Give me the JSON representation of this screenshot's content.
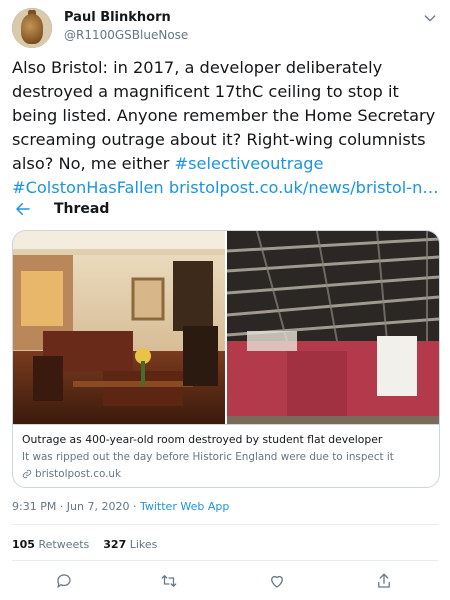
{
  "author": {
    "name": "Paul Blinkhorn",
    "handle": "@R1100GSBlueNose"
  },
  "tweet": {
    "text_plain": "Also Bristol: in 2017, a developer deliberately destroyed a magnificent 17thC ceiling to stop it being listed. Anyone remember the Home Secretary screaming outrage about it? Right-wing columnists also? No, me either ",
    "hashtag1": "#selectiveoutrage",
    "hashtag2": "#ColstonHasFallen",
    "link": "bristolpost.co.uk/news/bristol-n…"
  },
  "thread": {
    "label": "Thread"
  },
  "card": {
    "title": "Outrage as 400-year-old room destroyed by student flat developer",
    "description": "It was ripped out the day before Historic England were due to inspect it",
    "domain": "bristolpost.co.uk"
  },
  "meta": {
    "time": "9:31 PM · Jun 7, 2020 · ",
    "app": "Twitter Web App"
  },
  "stats": {
    "retweets_count": "105",
    "retweets_label": "Retweets",
    "likes_count": "327",
    "likes_label": "Likes"
  },
  "icons": {
    "chevron": "chevron-down-icon",
    "back": "back-arrow-icon",
    "link": "link-icon",
    "reply": "reply-icon",
    "retweet": "retweet-icon",
    "like": "heart-icon",
    "share": "share-icon"
  },
  "colors": {
    "link": "#1b95e0",
    "secondary": "#657786",
    "border": "#ccd6dd"
  }
}
